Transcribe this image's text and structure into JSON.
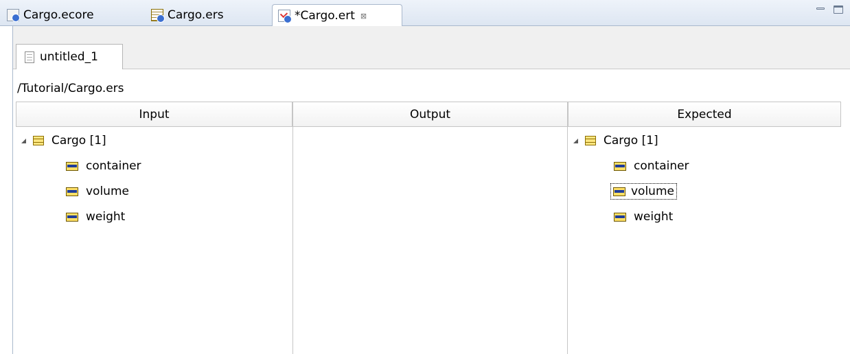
{
  "editor_tabs": [
    {
      "label": "Cargo.ecore",
      "icon": "ecore-file-icon",
      "active": false
    },
    {
      "label": "Cargo.ers",
      "icon": "ers-file-icon",
      "active": false
    },
    {
      "label": "*Cargo.ert",
      "icon": "ert-file-icon",
      "active": true,
      "close": "⊠"
    }
  ],
  "window_controls": {
    "minimize": "minimize-icon",
    "maximize": "maximize-icon"
  },
  "subtab": {
    "label": "untitled_1",
    "icon": "document-icon"
  },
  "path": "/Tutorial/Cargo.ers",
  "columns": {
    "input": {
      "header": "Input",
      "tree": {
        "label": "Cargo [1]",
        "children": [
          "container",
          "volume",
          "weight"
        ]
      }
    },
    "output": {
      "header": "Output"
    },
    "expected": {
      "header": "Expected",
      "tree": {
        "label": "Cargo [1]",
        "children": [
          "container",
          "volume",
          "weight"
        ],
        "focused": "volume"
      }
    }
  }
}
